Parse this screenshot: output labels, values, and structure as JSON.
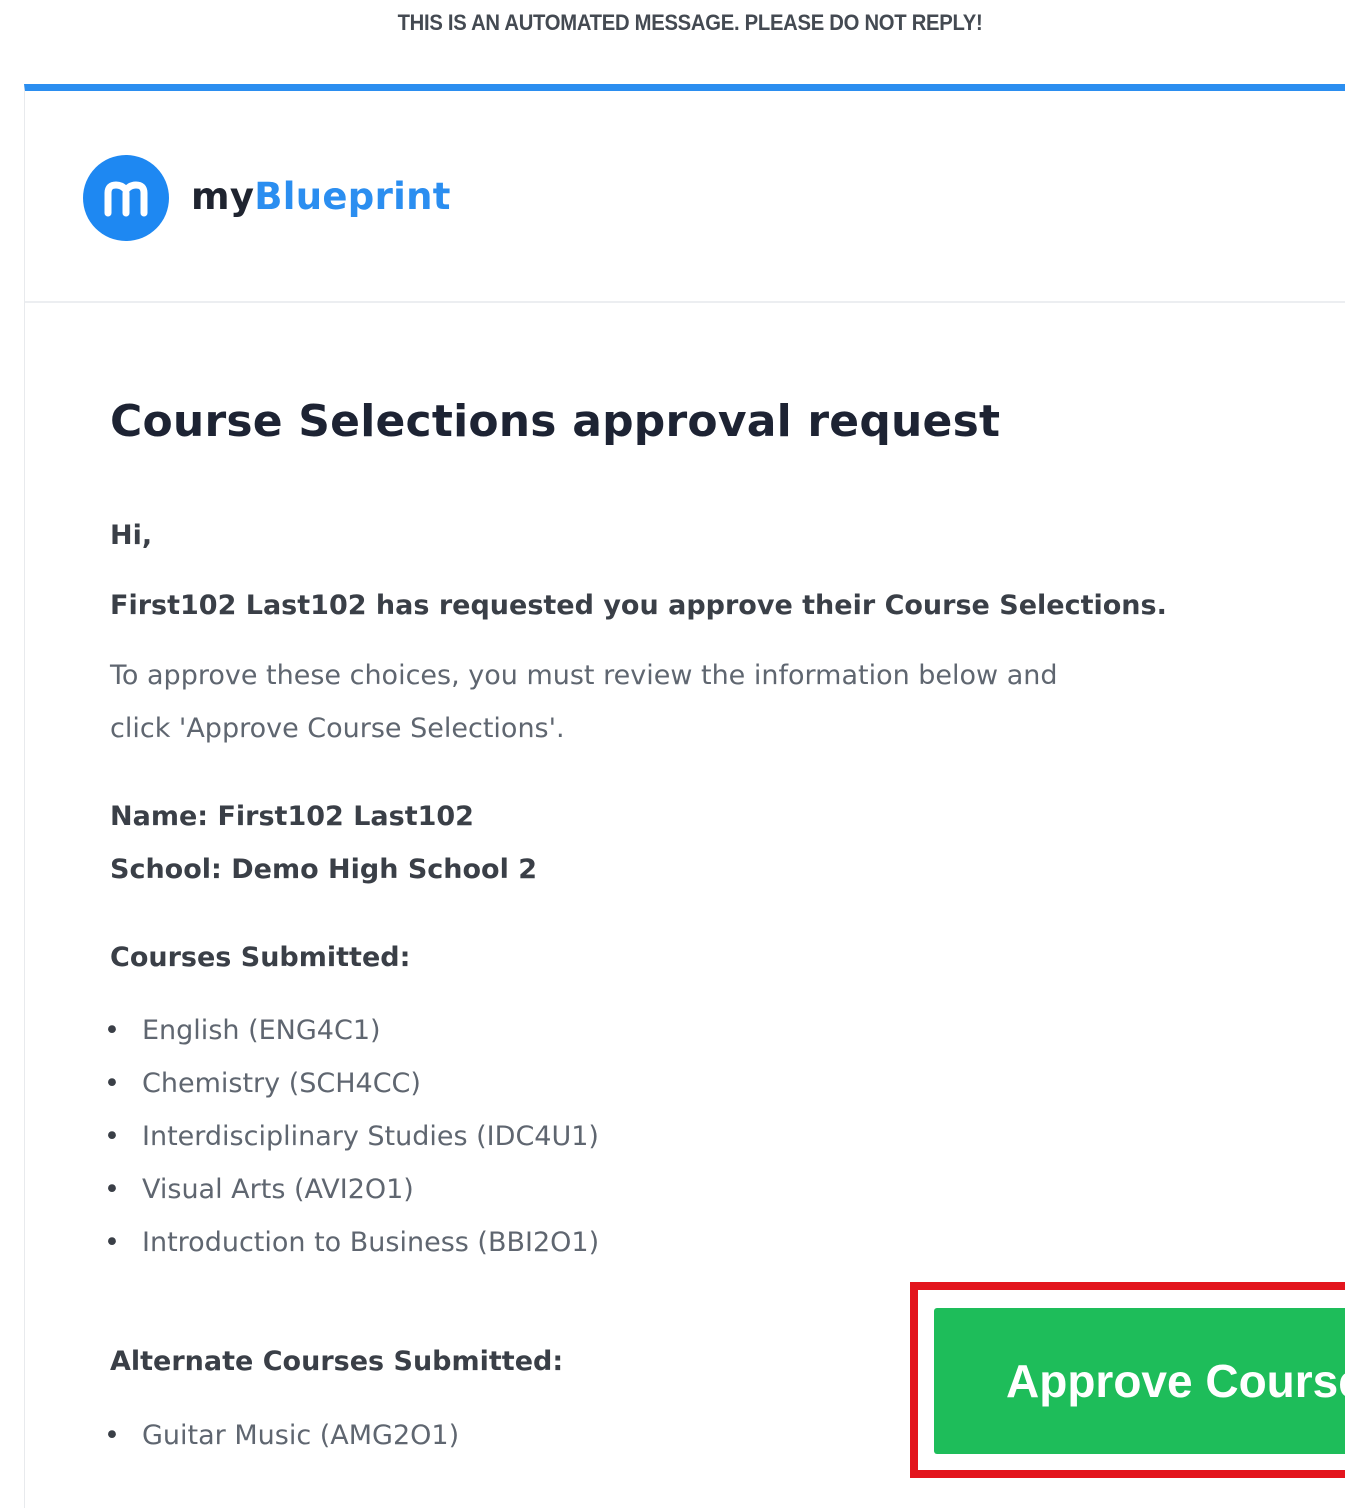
{
  "notice": "THIS IS AN AUTOMATED MESSAGE. PLEASE DO NOT REPLY!",
  "brand": {
    "logo_icon": "m-logo-icon",
    "name_part1": "my",
    "name_part2": "Blueprint",
    "accent_color": "#2b8ef0"
  },
  "email": {
    "title": "Course Selections approval request",
    "greeting": "Hi,",
    "request_line": "First102 Last102 has requested you approve their Course Selections.",
    "instruction_line1": "To approve these choices, you must review the information below and",
    "instruction_line2": "click 'Approve Course Selections'.",
    "name_line": "Name: First102 Last102",
    "school_line": "School: Demo High School 2",
    "courses_label": "Courses Submitted:",
    "courses": [
      "English (ENG4C1)",
      "Chemistry (SCH4CC)",
      "Interdisciplinary Studies (IDC4U1)",
      "Visual Arts (AVI2O1)",
      "Introduction to Business (BBI2O1)"
    ],
    "alternates_label": "Alternate Courses Submitted:",
    "alternates": [
      "Guitar Music (AMG2O1)"
    ],
    "bullet": "•",
    "approve_button": "Approve Course",
    "button_color": "#1ebd5a",
    "highlight_color": "#e3151d"
  }
}
